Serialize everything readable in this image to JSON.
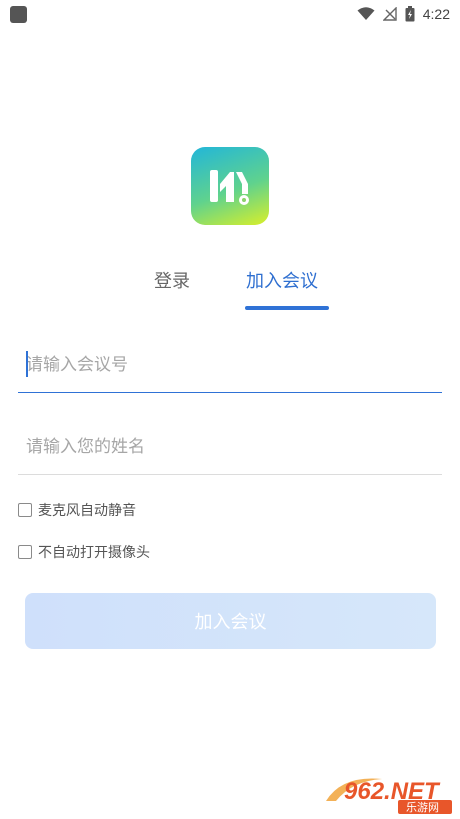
{
  "status_bar": {
    "time": "4:22",
    "icons": [
      "app-icon",
      "wifi-icon",
      "signal-icon",
      "battery-icon"
    ]
  },
  "tabs": [
    {
      "label": "登录",
      "active": false
    },
    {
      "label": "加入会议",
      "active": true
    }
  ],
  "form": {
    "meeting_id": {
      "placeholder": "请输入会议号",
      "value": ""
    },
    "name": {
      "placeholder": "请输入您的姓名",
      "value": ""
    },
    "options": [
      {
        "label": "麦克风自动静音",
        "checked": false
      },
      {
        "label": "不自动打开摄像头",
        "checked": false
      }
    ],
    "submit_label": "加入会议"
  },
  "watermark": {
    "brand": "962.NET",
    "subtitle": "乐游网"
  },
  "colors": {
    "accent": "#2f72d6",
    "button_bg": "#cfe0fb",
    "logo_gradient": [
      "#22b6d9",
      "#5fd28e",
      "#d9ef2a"
    ]
  }
}
